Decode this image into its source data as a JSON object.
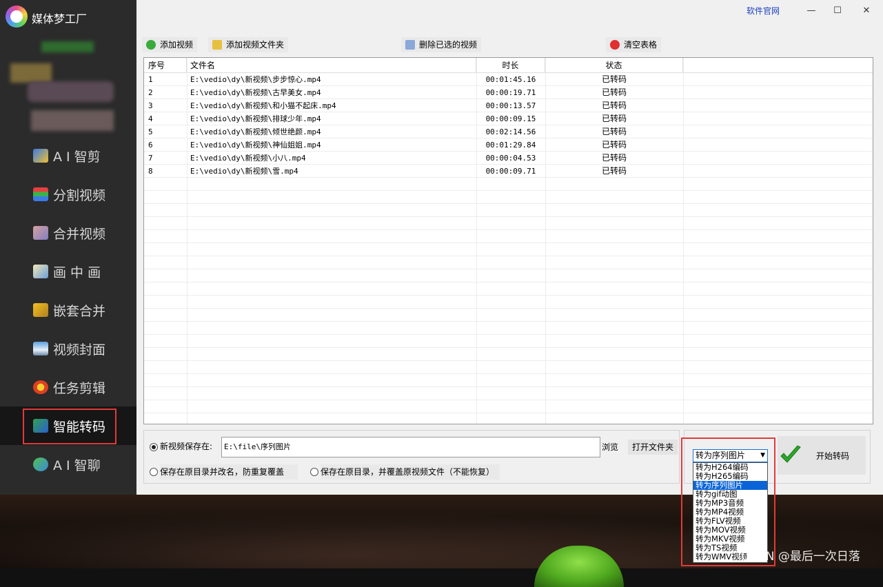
{
  "app": {
    "title": "媒体梦工厂"
  },
  "sidebar": {
    "items": [
      {
        "label": "A I 智剪",
        "icon": "ai-cut-icon"
      },
      {
        "label": "分割视频",
        "icon": "split-video-icon"
      },
      {
        "label": "合并视频",
        "icon": "merge-video-icon"
      },
      {
        "label": "画 中 画",
        "icon": "picture-in-picture-icon"
      },
      {
        "label": "嵌套合并",
        "icon": "nest-merge-icon"
      },
      {
        "label": "视频封面",
        "icon": "video-cover-icon"
      },
      {
        "label": "任务剪辑",
        "icon": "task-edit-icon"
      },
      {
        "label": "智能转码",
        "icon": "smart-transcode-icon",
        "active": true
      },
      {
        "label": "A I 智聊",
        "icon": "ai-chat-icon"
      }
    ]
  },
  "header": {
    "website_label": "软件官网"
  },
  "toolbar": {
    "add_video": "添加视频",
    "add_folder": "添加视频文件夹",
    "delete_selected": "删除已选的视频",
    "clear_table": "清空表格"
  },
  "table": {
    "columns": [
      "序号",
      "文件名",
      "时长",
      "状态"
    ],
    "rows": [
      [
        "1",
        "E:\\vedio\\dy\\新视频\\步步惊心.mp4",
        "00:01:45.16",
        "已转码"
      ],
      [
        "2",
        "E:\\vedio\\dy\\新视频\\古早美女.mp4",
        "00:00:19.71",
        "已转码"
      ],
      [
        "3",
        "E:\\vedio\\dy\\新视频\\和小猫不起床.mp4",
        "00:00:13.57",
        "已转码"
      ],
      [
        "4",
        "E:\\vedio\\dy\\新视频\\排球少年.mp4",
        "00:00:09.15",
        "已转码"
      ],
      [
        "5",
        "E:\\vedio\\dy\\新视频\\倾世绝颜.mp4",
        "00:02:14.56",
        "已转码"
      ],
      [
        "6",
        "E:\\vedio\\dy\\新视频\\神仙姐姐.mp4",
        "00:01:29.84",
        "已转码"
      ],
      [
        "7",
        "E:\\vedio\\dy\\新视频\\小八.mp4",
        "00:00:04.53",
        "已转码"
      ],
      [
        "8",
        "E:\\vedio\\dy\\新视频\\雪.mp4",
        "00:00:09.71",
        "已转码"
      ]
    ]
  },
  "save": {
    "option_new_label": "新视频保存在:",
    "path_value": "E:\\file\\序列图片",
    "browse_label": "浏览",
    "open_folder_label": "打开文件夹",
    "option_rename_label": "保存在原目录并改名，防重复覆盖",
    "option_overwrite_label": "保存在原目录，并覆盖原视频文件（不能恢复）"
  },
  "transcode": {
    "selected": "转为序列图片",
    "options": [
      "转为H264编码",
      "转为H265编码",
      "转为序列图片",
      "转为gif动图",
      "转为MP3音频",
      "转为MP4视频",
      "转为FLV视频",
      "转为MOV视频",
      "转为MKV视频",
      "转为TS视频",
      "转为WMV视频"
    ],
    "selected_index": 2,
    "start_label": "开始转码"
  },
  "watermark": "CSDN @最后一次日落",
  "colors": {
    "sidebar_bg": "#2b2b2b",
    "highlight_red": "#e23a3a",
    "selection_blue": "#0a64d8"
  }
}
